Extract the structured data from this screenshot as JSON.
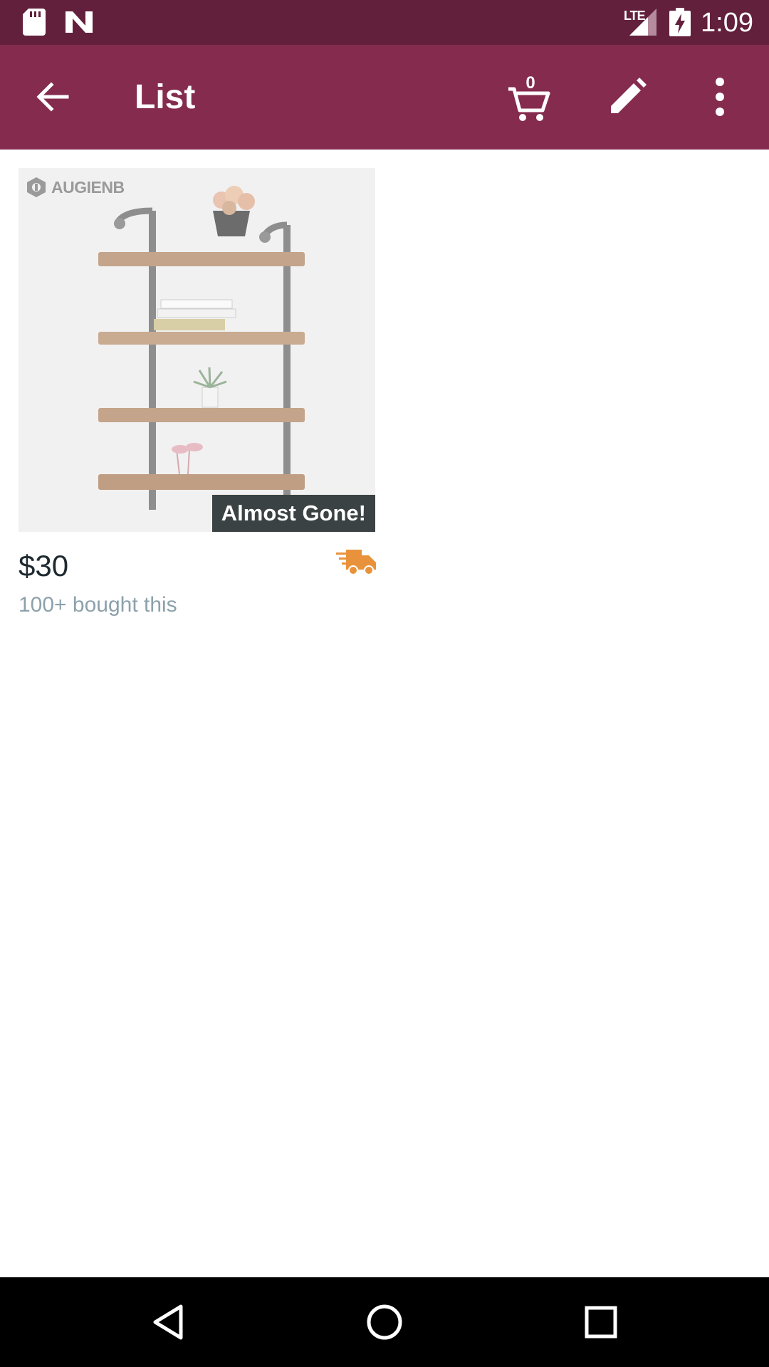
{
  "status_bar": {
    "time": "1:09",
    "network": "LTE"
  },
  "app_bar": {
    "title": "List",
    "cart_count": "0"
  },
  "product": {
    "brand_logo": "AUGIENB",
    "badge": "Almost Gone!",
    "price": "$30",
    "bought_text": "100+ bought this",
    "shipping_icon": "truck-icon"
  },
  "colors": {
    "status_bar": "#62203c",
    "app_bar": "#842b4e",
    "badge": "#3b4244",
    "truck": "#e8933b",
    "secondary_text": "#8ca1ab"
  }
}
